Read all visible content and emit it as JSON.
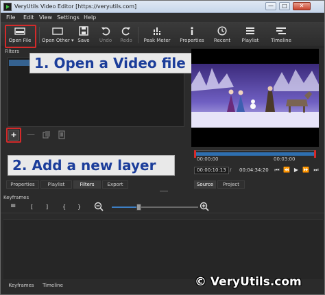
{
  "window": {
    "title": "VeryUtils Video Editor [https://veryutils.com]",
    "min_glyph": "—",
    "max_glyph": "□",
    "close_glyph": "✕"
  },
  "menu": {
    "items": [
      "File",
      "Edit",
      "View",
      "Settings",
      "Help"
    ]
  },
  "toolbar": {
    "items": [
      {
        "label": "Open File",
        "icon": "folder-icon"
      },
      {
        "label": "Open Other",
        "icon": "folder-open-icon"
      },
      {
        "label": "Save",
        "icon": "save-icon"
      },
      {
        "label": "Undo",
        "icon": "undo-icon"
      },
      {
        "label": "Redo",
        "icon": "redo-icon"
      },
      {
        "label": "Peak Meter",
        "icon": "meter-icon"
      },
      {
        "label": "Properties",
        "icon": "info-icon"
      },
      {
        "label": "Recent",
        "icon": "clock-icon"
      },
      {
        "label": "Playlist",
        "icon": "list-icon"
      },
      {
        "label": "Timeline",
        "icon": "timeline-icon"
      }
    ]
  },
  "filters": {
    "title": "Filters",
    "add_glyph": "+",
    "remove_glyph": "—"
  },
  "callouts": {
    "step1": "1. Open a Video file",
    "step2": "2. Add a new layer"
  },
  "player": {
    "tick_start": "00:00:00",
    "tick_end": "00:03:00",
    "current_time": "00:00:10:13",
    "separator": "/",
    "total_time": "00:04:34:20",
    "tabs": [
      "Source",
      "Project"
    ],
    "active_tab": "Source"
  },
  "left_tabs": {
    "items": [
      "Properties",
      "Playlist",
      "Filters",
      "Export"
    ],
    "active": "Filters"
  },
  "keyframes": {
    "title": "Keyframes",
    "tools": [
      "≡",
      "[",
      "]",
      "{",
      "}"
    ]
  },
  "bottom_tabs": [
    "Keyframes",
    "Timeline"
  ],
  "watermark": "© VeryUtils.com",
  "colors": {
    "accent": "#3a6ea5",
    "highlight": "#d42a2a",
    "callout_text": "#1b3d9a"
  }
}
